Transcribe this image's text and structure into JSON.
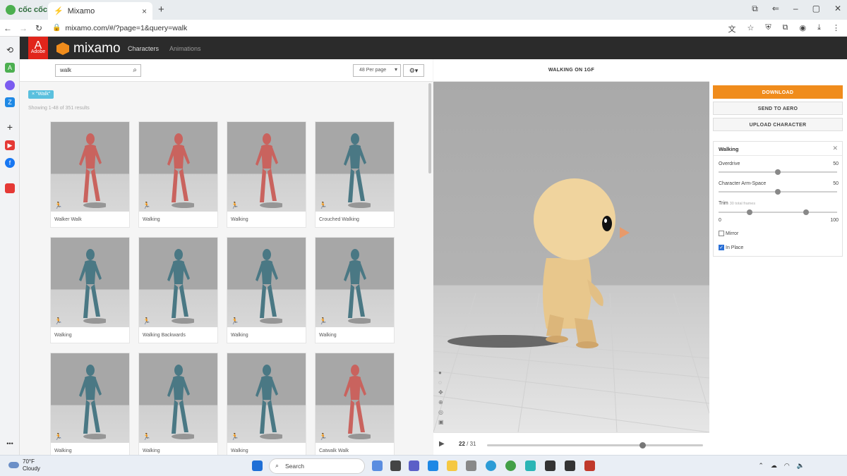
{
  "browser": {
    "brand": "cốc cốc",
    "tab_title": "Mixamo",
    "tab_close": "×",
    "new_tab": "+",
    "url": "mixamo.com/#/?page=1&query=walk",
    "window_controls": [
      "⧉",
      "⇐",
      "–",
      "▢",
      "✕"
    ],
    "address_right_icons": [
      "translate-icon",
      "star-icon",
      "shield-icon",
      "extensions-icon",
      "profile-icon",
      "download-icon",
      "menu-icon"
    ]
  },
  "browser_sidebar": [
    "history-icon",
    "ai-icon",
    "messenger-icon",
    "zalo-icon",
    "add-icon",
    "youtube-icon",
    "facebook-icon",
    "calendar-icon",
    "more-icon"
  ],
  "mixamo": {
    "adobe_label": "Adobe",
    "logo_text": "mixamo",
    "nav": {
      "characters": "Characters",
      "animations": "Animations"
    },
    "search_value": "walk",
    "per_page": "48 Per page",
    "filter_tag": "× \"Walk\"",
    "results_text": "Showing 1-48 of 351 results",
    "cards": [
      {
        "label": "Walker Walk",
        "color": "#c9635e"
      },
      {
        "label": "Walking",
        "color": "#c9635e"
      },
      {
        "label": "Walking",
        "color": "#c9635e"
      },
      {
        "label": "Crouched Walking",
        "color": "#4a7884"
      },
      {
        "label": "Walking",
        "color": "#4a7884"
      },
      {
        "label": "Walking Backwards",
        "color": "#4a7884"
      },
      {
        "label": "Walking",
        "color": "#4a7884"
      },
      {
        "label": "Walking",
        "color": "#4a7884"
      },
      {
        "label": "Walking",
        "color": "#4a7884"
      },
      {
        "label": "Walking",
        "color": "#4a7884"
      },
      {
        "label": "Walking",
        "color": "#4a7884"
      },
      {
        "label": "Catwalk Walk",
        "color": "#c9635e"
      }
    ],
    "viewer_title": "WALKING ON 1GF",
    "frame_current": "22",
    "frame_total": "/ 31",
    "playhead_fraction": 0.72,
    "buttons": {
      "download": "DOWNLOAD",
      "send": "SEND TO AERO",
      "upload": "UPLOAD CHARACTER"
    },
    "settings": {
      "title": "Walking",
      "overdrive_label": "Overdrive",
      "overdrive_value": "50",
      "armspace_label": "Character Arm-Space",
      "armspace_value": "50",
      "trim_label": "Trim",
      "trim_note": "30 total frames",
      "trim_min": "0",
      "trim_max": "100",
      "mirror_label": "Mirror",
      "inplace_label": "In Place"
    }
  },
  "taskbar": {
    "temp": "70°F",
    "condition": "Cloudy",
    "search_placeholder": "Search"
  },
  "colors": {
    "accent": "#f08c1c",
    "header": "#2b2b2b",
    "tag": "#5bc0de"
  }
}
